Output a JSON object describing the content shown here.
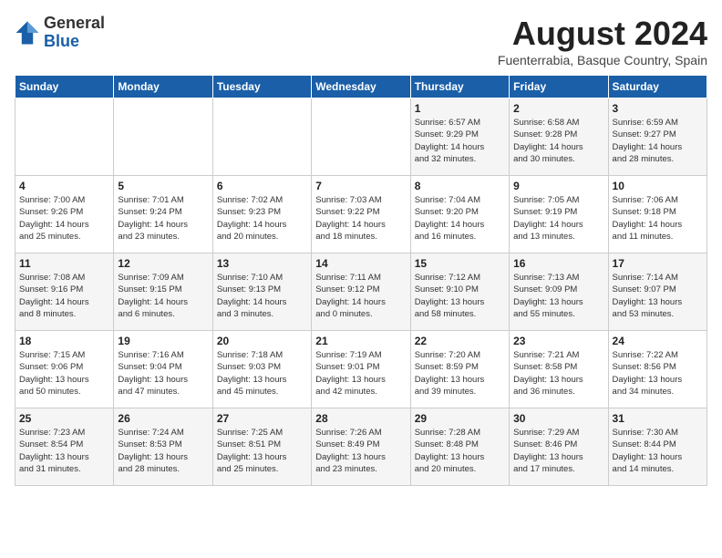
{
  "header": {
    "logo_general": "General",
    "logo_blue": "Blue",
    "month_year": "August 2024",
    "location": "Fuenterrabia, Basque Country, Spain"
  },
  "days_of_week": [
    "Sunday",
    "Monday",
    "Tuesday",
    "Wednesday",
    "Thursday",
    "Friday",
    "Saturday"
  ],
  "weeks": [
    [
      {
        "num": "",
        "info": ""
      },
      {
        "num": "",
        "info": ""
      },
      {
        "num": "",
        "info": ""
      },
      {
        "num": "",
        "info": ""
      },
      {
        "num": "1",
        "info": "Sunrise: 6:57 AM\nSunset: 9:29 PM\nDaylight: 14 hours\nand 32 minutes."
      },
      {
        "num": "2",
        "info": "Sunrise: 6:58 AM\nSunset: 9:28 PM\nDaylight: 14 hours\nand 30 minutes."
      },
      {
        "num": "3",
        "info": "Sunrise: 6:59 AM\nSunset: 9:27 PM\nDaylight: 14 hours\nand 28 minutes."
      }
    ],
    [
      {
        "num": "4",
        "info": "Sunrise: 7:00 AM\nSunset: 9:26 PM\nDaylight: 14 hours\nand 25 minutes."
      },
      {
        "num": "5",
        "info": "Sunrise: 7:01 AM\nSunset: 9:24 PM\nDaylight: 14 hours\nand 23 minutes."
      },
      {
        "num": "6",
        "info": "Sunrise: 7:02 AM\nSunset: 9:23 PM\nDaylight: 14 hours\nand 20 minutes."
      },
      {
        "num": "7",
        "info": "Sunrise: 7:03 AM\nSunset: 9:22 PM\nDaylight: 14 hours\nand 18 minutes."
      },
      {
        "num": "8",
        "info": "Sunrise: 7:04 AM\nSunset: 9:20 PM\nDaylight: 14 hours\nand 16 minutes."
      },
      {
        "num": "9",
        "info": "Sunrise: 7:05 AM\nSunset: 9:19 PM\nDaylight: 14 hours\nand 13 minutes."
      },
      {
        "num": "10",
        "info": "Sunrise: 7:06 AM\nSunset: 9:18 PM\nDaylight: 14 hours\nand 11 minutes."
      }
    ],
    [
      {
        "num": "11",
        "info": "Sunrise: 7:08 AM\nSunset: 9:16 PM\nDaylight: 14 hours\nand 8 minutes."
      },
      {
        "num": "12",
        "info": "Sunrise: 7:09 AM\nSunset: 9:15 PM\nDaylight: 14 hours\nand 6 minutes."
      },
      {
        "num": "13",
        "info": "Sunrise: 7:10 AM\nSunset: 9:13 PM\nDaylight: 14 hours\nand 3 minutes."
      },
      {
        "num": "14",
        "info": "Sunrise: 7:11 AM\nSunset: 9:12 PM\nDaylight: 14 hours\nand 0 minutes."
      },
      {
        "num": "15",
        "info": "Sunrise: 7:12 AM\nSunset: 9:10 PM\nDaylight: 13 hours\nand 58 minutes."
      },
      {
        "num": "16",
        "info": "Sunrise: 7:13 AM\nSunset: 9:09 PM\nDaylight: 13 hours\nand 55 minutes."
      },
      {
        "num": "17",
        "info": "Sunrise: 7:14 AM\nSunset: 9:07 PM\nDaylight: 13 hours\nand 53 minutes."
      }
    ],
    [
      {
        "num": "18",
        "info": "Sunrise: 7:15 AM\nSunset: 9:06 PM\nDaylight: 13 hours\nand 50 minutes."
      },
      {
        "num": "19",
        "info": "Sunrise: 7:16 AM\nSunset: 9:04 PM\nDaylight: 13 hours\nand 47 minutes."
      },
      {
        "num": "20",
        "info": "Sunrise: 7:18 AM\nSunset: 9:03 PM\nDaylight: 13 hours\nand 45 minutes."
      },
      {
        "num": "21",
        "info": "Sunrise: 7:19 AM\nSunset: 9:01 PM\nDaylight: 13 hours\nand 42 minutes."
      },
      {
        "num": "22",
        "info": "Sunrise: 7:20 AM\nSunset: 8:59 PM\nDaylight: 13 hours\nand 39 minutes."
      },
      {
        "num": "23",
        "info": "Sunrise: 7:21 AM\nSunset: 8:58 PM\nDaylight: 13 hours\nand 36 minutes."
      },
      {
        "num": "24",
        "info": "Sunrise: 7:22 AM\nSunset: 8:56 PM\nDaylight: 13 hours\nand 34 minutes."
      }
    ],
    [
      {
        "num": "25",
        "info": "Sunrise: 7:23 AM\nSunset: 8:54 PM\nDaylight: 13 hours\nand 31 minutes."
      },
      {
        "num": "26",
        "info": "Sunrise: 7:24 AM\nSunset: 8:53 PM\nDaylight: 13 hours\nand 28 minutes."
      },
      {
        "num": "27",
        "info": "Sunrise: 7:25 AM\nSunset: 8:51 PM\nDaylight: 13 hours\nand 25 minutes."
      },
      {
        "num": "28",
        "info": "Sunrise: 7:26 AM\nSunset: 8:49 PM\nDaylight: 13 hours\nand 23 minutes."
      },
      {
        "num": "29",
        "info": "Sunrise: 7:28 AM\nSunset: 8:48 PM\nDaylight: 13 hours\nand 20 minutes."
      },
      {
        "num": "30",
        "info": "Sunrise: 7:29 AM\nSunset: 8:46 PM\nDaylight: 13 hours\nand 17 minutes."
      },
      {
        "num": "31",
        "info": "Sunrise: 7:30 AM\nSunset: 8:44 PM\nDaylight: 13 hours\nand 14 minutes."
      }
    ]
  ]
}
